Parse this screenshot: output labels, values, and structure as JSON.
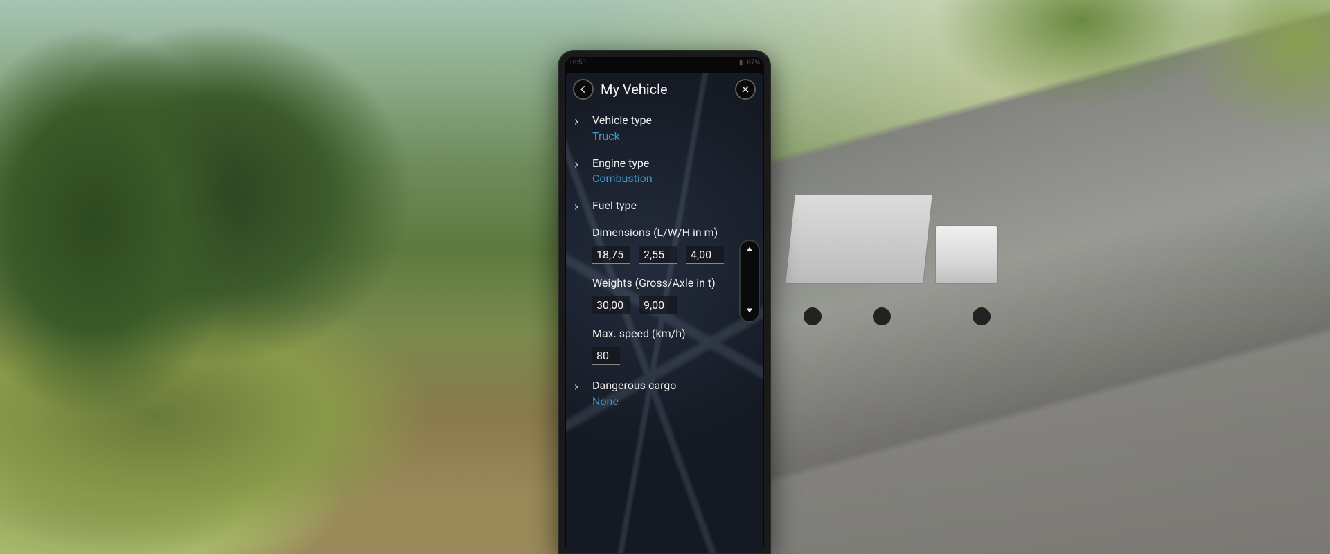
{
  "statusbar": {
    "time": "16:53",
    "battery_pct": "67%"
  },
  "header": {
    "title": "My Vehicle"
  },
  "rows": {
    "vehicle_type": {
      "label": "Vehicle type",
      "value": "Truck"
    },
    "engine_type": {
      "label": "Engine type",
      "value": "Combustion"
    },
    "fuel_type": {
      "label": "Fuel type",
      "value": ""
    },
    "dangerous_cargo": {
      "label": "Dangerous cargo",
      "value": "None"
    }
  },
  "dimensions": {
    "label": "Dimensions (L/W/H in m)",
    "length": "18,75",
    "width": "2,55",
    "height": "4,00"
  },
  "weights": {
    "label": "Weights (Gross/Axle in t)",
    "gross": "30,00",
    "axle": "9,00"
  },
  "max_speed": {
    "label": "Max. speed (km/h)",
    "value": "80"
  }
}
